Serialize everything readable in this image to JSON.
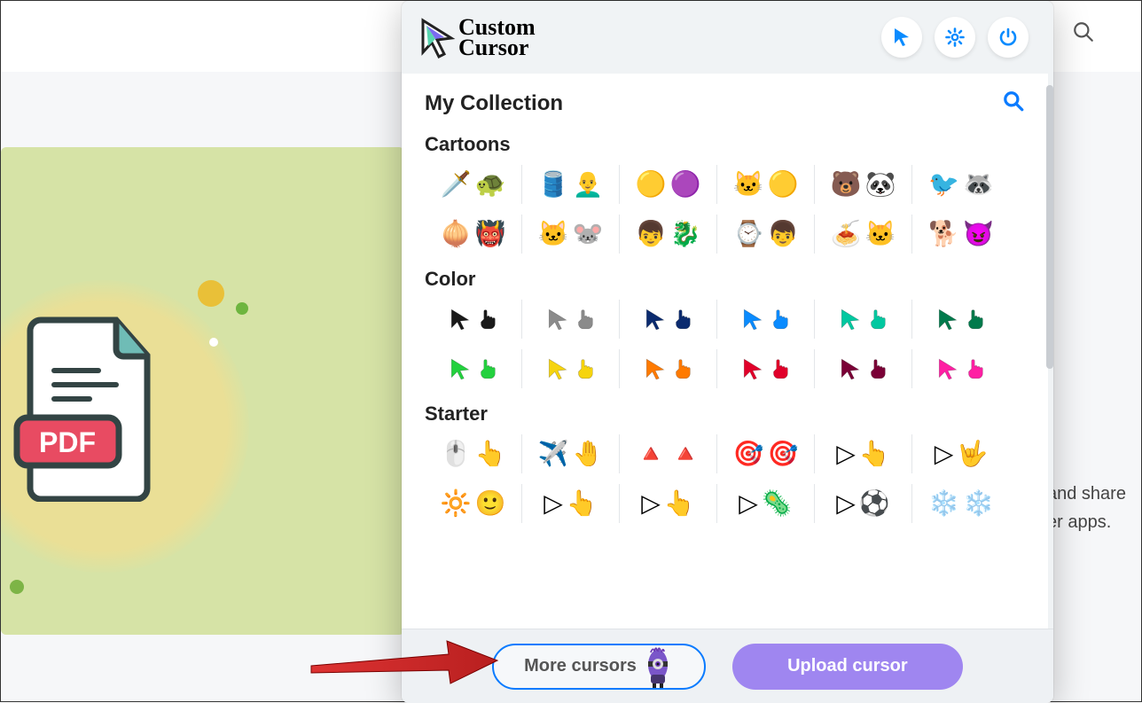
{
  "popup": {
    "brand_top": "Custom",
    "brand_bottom": "Cursor",
    "collection_title": "My Collection",
    "categories": [
      {
        "name": "Cartoons",
        "rows": [
          [
            {
              "name": "ninja-turtle",
              "icons": [
                "🗡️",
                "🐢"
              ]
            },
            {
              "name": "popeye",
              "icons": [
                "🛢️",
                "👨‍🦲"
              ]
            },
            {
              "name": "minions",
              "icons": [
                "🟡",
                "🟣"
              ]
            },
            {
              "name": "felix",
              "icons": [
                "🐱",
                "🟡"
              ]
            },
            {
              "name": "bears",
              "icons": [
                "🐻",
                "🐼"
              ]
            },
            {
              "name": "regular-show",
              "icons": [
                "🐦",
                "🦝"
              ]
            }
          ],
          [
            {
              "name": "shrek",
              "icons": [
                "🧅",
                "👹"
              ]
            },
            {
              "name": "tom-jerry",
              "icons": [
                "🐱",
                "🐭"
              ]
            },
            {
              "name": "dragon-trainer",
              "icons": [
                "👦",
                "🐉"
              ]
            },
            {
              "name": "ben10",
              "icons": [
                "⌚",
                "👦"
              ]
            },
            {
              "name": "garfield",
              "icons": [
                "🍝",
                "🐱"
              ]
            },
            {
              "name": "grinch",
              "icons": [
                "🐕",
                "😈"
              ]
            }
          ]
        ]
      },
      {
        "name": "Color",
        "rows": [
          [
            {
              "name": "black",
              "arrow": "#1a1a1a",
              "hand": "#1a1a1a"
            },
            {
              "name": "gray",
              "arrow": "#8b8b8b",
              "hand": "#8b8b8b"
            },
            {
              "name": "navy",
              "arrow": "#0b2b6f",
              "hand": "#0b2b6f"
            },
            {
              "name": "blue",
              "arrow": "#0a8bff",
              "hand": "#0a8bff"
            },
            {
              "name": "teal",
              "arrow": "#00c8a0",
              "hand": "#00c8a0"
            },
            {
              "name": "dkgreen",
              "arrow": "#007a4c",
              "hand": "#007a4c"
            }
          ],
          [
            {
              "name": "green",
              "arrow": "#23d13e",
              "hand": "#23d13e"
            },
            {
              "name": "yellow",
              "arrow": "#f6d40e",
              "hand": "#f6d40e"
            },
            {
              "name": "orange",
              "arrow": "#ff7a00",
              "hand": "#ff7a00"
            },
            {
              "name": "red",
              "arrow": "#e1002a",
              "hand": "#e1002a"
            },
            {
              "name": "wine",
              "arrow": "#7a0036",
              "hand": "#7a0036"
            },
            {
              "name": "pink",
              "arrow": "#ff1fa3",
              "hand": "#ff1fa3"
            }
          ]
        ]
      },
      {
        "name": "Starter",
        "rows": [
          [
            {
              "name": "holo",
              "icons": [
                "🖱️",
                "👆"
              ]
            },
            {
              "name": "paper-plane",
              "icons": [
                "✈️",
                "🤚"
              ]
            },
            {
              "name": "stone",
              "icons": [
                "🔺",
                "🔺"
              ]
            },
            {
              "name": "crosshair",
              "icons": [
                "🎯",
                "🎯"
              ]
            },
            {
              "name": "outline",
              "icons": [
                "▷",
                "👆"
              ]
            },
            {
              "name": "pixel",
              "icons": [
                "▷",
                "🤟"
              ]
            }
          ],
          [
            {
              "name": "emoji",
              "icons": [
                "🔆",
                "🙂"
              ]
            },
            {
              "name": "rainbow",
              "icons": [
                "▷",
                "👆"
              ]
            },
            {
              "name": "purple-hand",
              "icons": [
                "▷",
                "👆"
              ]
            },
            {
              "name": "slime",
              "icons": [
                "▷",
                "🦠"
              ]
            },
            {
              "name": "soccer",
              "icons": [
                "▷",
                "⚽"
              ]
            },
            {
              "name": "snowflake",
              "icons": [
                "❄️",
                "❄️"
              ]
            }
          ]
        ]
      }
    ],
    "footer": {
      "more_cursors": "More cursors",
      "upload_cursor": "Upload cursor"
    }
  },
  "page": {
    "text_tail_1": "and share",
    "text_tail_2": "er apps.",
    "pdf_label": "PDF"
  }
}
